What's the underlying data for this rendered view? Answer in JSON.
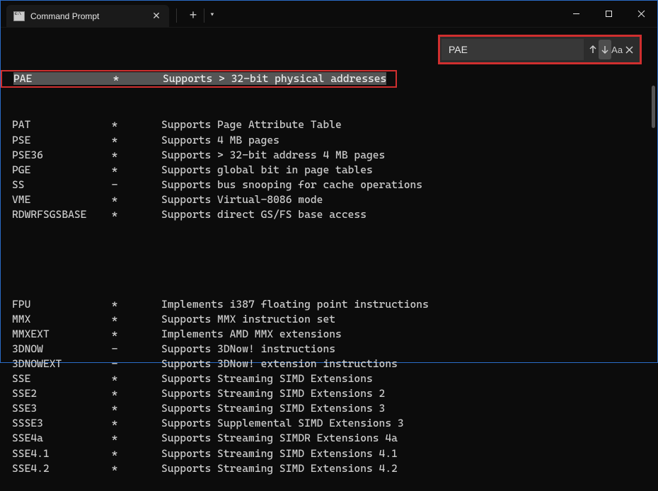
{
  "window": {
    "tab_title": "Command Prompt",
    "new_tab_label": "+"
  },
  "find": {
    "value": "PAE"
  },
  "terminal": {
    "match": {
      "name": "PAE",
      "flag": "*",
      "desc": "Supports > 32-bit physical addresses"
    },
    "rows_a": [
      {
        "name": "PAT",
        "flag": "*",
        "desc": "Supports Page Attribute Table"
      },
      {
        "name": "PSE",
        "flag": "*",
        "desc": "Supports 4 MB pages"
      },
      {
        "name": "PSE36",
        "flag": "*",
        "desc": "Supports > 32-bit address 4 MB pages"
      },
      {
        "name": "PGE",
        "flag": "*",
        "desc": "Supports global bit in page tables"
      },
      {
        "name": "SS",
        "flag": "-",
        "desc": "Supports bus snooping for cache operations"
      },
      {
        "name": "VME",
        "flag": "*",
        "desc": "Supports Virtual-8086 mode"
      },
      {
        "name": "RDWRFSGSBASE",
        "flag": "*",
        "desc": "Supports direct GS/FS base access"
      }
    ],
    "rows_b": [
      {
        "name": "FPU",
        "flag": "*",
        "desc": "Implements i387 floating point instructions"
      },
      {
        "name": "MMX",
        "flag": "*",
        "desc": "Supports MMX instruction set"
      },
      {
        "name": "MMXEXT",
        "flag": "*",
        "desc": "Implements AMD MMX extensions"
      },
      {
        "name": "3DNOW",
        "flag": "-",
        "desc": "Supports 3DNow! instructions"
      },
      {
        "name": "3DNOWEXT",
        "flag": "-",
        "desc": "Supports 3DNow! extension instructions"
      },
      {
        "name": "SSE",
        "flag": "*",
        "desc": "Supports Streaming SIMD Extensions"
      },
      {
        "name": "SSE2",
        "flag": "*",
        "desc": "Supports Streaming SIMD Extensions 2"
      },
      {
        "name": "SSE3",
        "flag": "*",
        "desc": "Supports Streaming SIMD Extensions 3"
      },
      {
        "name": "SSSE3",
        "flag": "*",
        "desc": "Supports Supplemental SIMD Extensions 3"
      },
      {
        "name": "SSE4a",
        "flag": "*",
        "desc": "Supports Streaming SIMDR Extensions 4a"
      },
      {
        "name": "SSE4.1",
        "flag": "*",
        "desc": "Supports Streaming SIMD Extensions 4.1"
      },
      {
        "name": "SSE4.2",
        "flag": "*",
        "desc": "Supports Streaming SIMD Extensions 4.2"
      }
    ]
  }
}
